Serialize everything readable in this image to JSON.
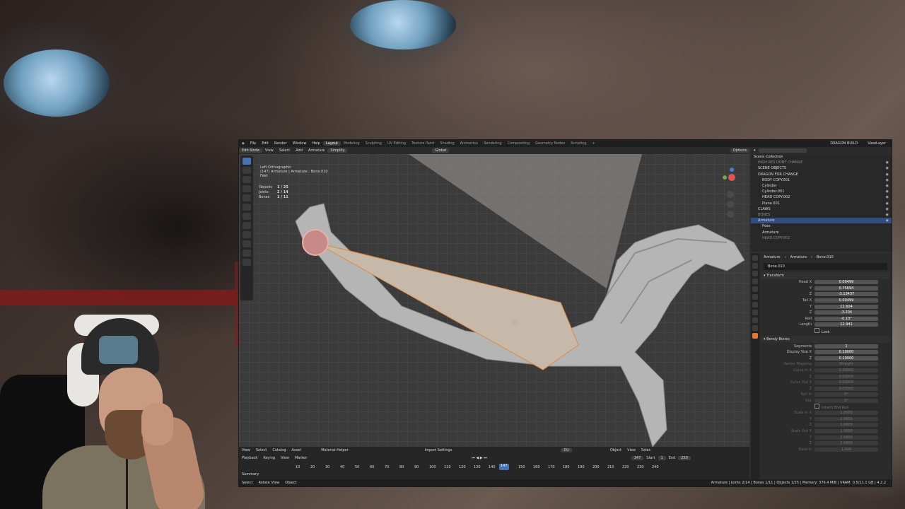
{
  "colors": {
    "accent": "#4772b3",
    "active_orange": "#e07a2e",
    "selected_row": "#334d80"
  },
  "menubar": {
    "menus": [
      "File",
      "Edit",
      "Render",
      "Window",
      "Help"
    ],
    "workspaces": [
      "Layout",
      "Modeling",
      "Sculpting",
      "UV Editing",
      "Texture Paint",
      "Shading",
      "Animation",
      "Rendering",
      "Compositing",
      "Geometry Nodes",
      "Scripting"
    ],
    "active_workspace": "Layout",
    "add_tab": "+",
    "scene_name": "DRAGON BUILD",
    "view_layer": "ViewLayer"
  },
  "viewport_header": {
    "mode": "Edit Mode",
    "items": [
      "View",
      "Select",
      "Add",
      "Armature"
    ],
    "simplify": "Simplify",
    "orientation": "Global",
    "options": "Options"
  },
  "viewport": {
    "view_name": "Left Orthographic",
    "active_object": "(147) Armature | Armature : Bone.010",
    "collection": "Feet",
    "stats": [
      {
        "label": "Objects",
        "value": "1 / 25"
      },
      {
        "label": "Joints",
        "value": "2 / 14"
      },
      {
        "label": "Bones",
        "value": "1 / 11"
      }
    ]
  },
  "timeline": {
    "editor_items": [
      "View",
      "Select",
      "Catalog",
      "Asset"
    ],
    "material_helper": "Material Helper",
    "import_settings": "Import Settings",
    "search_value": "DU",
    "object_label": "Object",
    "right_items": [
      "View",
      "Selec"
    ],
    "playback_items": [
      "Playback",
      "Keying",
      "View",
      "Marker"
    ],
    "current_frame": "147",
    "start_label": "Start",
    "start_value": "1",
    "end_label": "End",
    "end_value": "250",
    "summary": "Summary",
    "ticks": [
      "10",
      "20",
      "30",
      "40",
      "50",
      "60",
      "70",
      "80",
      "90",
      "100",
      "110",
      "120",
      "130",
      "140",
      "147",
      "150",
      "160",
      "170",
      "180",
      "190",
      "200",
      "210",
      "220",
      "230",
      "240"
    ]
  },
  "statusbar": {
    "left": [
      "Select",
      "Rotate View",
      "Object"
    ],
    "right": "Armature | Joints 2/14 | Bones 1/11 | Objects 1/25 | Memory: 376.4 MiB | VRAM: 0.5/11.1 GB | 4.2.2"
  },
  "outliner": {
    "title": "Scene Collection",
    "search_placeholder": "",
    "rows": [
      {
        "label": "HIGH RES DONT CHANGE",
        "indent": 1,
        "dim": true
      },
      {
        "label": "SCENE OBJECTS",
        "indent": 1,
        "dim": false
      },
      {
        "label": "DRAGON FOR CHANGE",
        "indent": 1,
        "dim": false
      },
      {
        "label": "BODY COPY.001",
        "indent": 2,
        "dim": false
      },
      {
        "label": "Cylinder",
        "indent": 2,
        "dim": false
      },
      {
        "label": "Cylinder.001",
        "indent": 2,
        "dim": false
      },
      {
        "label": "HEAD COPY.002",
        "indent": 2,
        "dim": false
      },
      {
        "label": "Plane.001",
        "indent": 2,
        "dim": false
      },
      {
        "label": "CLAWS",
        "indent": 1,
        "dim": false
      },
      {
        "label": "BONES",
        "indent": 1,
        "dim": true
      },
      {
        "label": "Armature",
        "indent": 1,
        "dim": false,
        "selected": true
      },
      {
        "label": "Pose",
        "indent": 2,
        "dim": false
      },
      {
        "label": "Armature",
        "indent": 2,
        "dim": false
      },
      {
        "label": "HEAD COPY.002",
        "indent": 2,
        "dim": true
      }
    ]
  },
  "properties": {
    "breadcrumb": [
      "Armature",
      "Armature",
      "Bone.010"
    ],
    "bone_name": "Bone.010",
    "transform_title": "Transform",
    "transform_fields": [
      {
        "label": "Head X",
        "value": "0.00499"
      },
      {
        "label": "Y",
        "value": "0.75694"
      },
      {
        "label": "Z",
        "value": "-3.13437"
      },
      {
        "label": "Tail X",
        "value": "0.00499"
      },
      {
        "label": "Y",
        "value": "12.604"
      },
      {
        "label": "Z",
        "value": "-3.204"
      },
      {
        "label": "Roll",
        "value": "-0.13°"
      },
      {
        "label": "Length",
        "value": "12.941"
      }
    ],
    "lock_label": "Lock",
    "bendy_title": "Bendy Bones",
    "bendy_fields": [
      {
        "label": "Segments",
        "value": "1",
        "dim": false
      },
      {
        "label": "Display Size X",
        "value": "0.10000",
        "dim": false
      },
      {
        "label": "Z",
        "value": "0.10000",
        "dim": false
      },
      {
        "label": "Vertex Mapping",
        "value": "Straight",
        "dim": true
      },
      {
        "label": "Curve In X",
        "value": "0.00000",
        "dim": true
      },
      {
        "label": "Z",
        "value": "0.00000",
        "dim": true
      },
      {
        "label": "Curve Out X",
        "value": "0.00000",
        "dim": true
      },
      {
        "label": "Z",
        "value": "0.00000",
        "dim": true
      },
      {
        "label": "Roll In",
        "value": "0°",
        "dim": true
      },
      {
        "label": "Out",
        "value": "0°",
        "dim": true
      }
    ],
    "inherit_label": "Inherit End Roll",
    "scale_fields": [
      {
        "label": "Scale In X",
        "value": "1.0000"
      },
      {
        "label": "Y",
        "value": "1.0000"
      },
      {
        "label": "Z",
        "value": "1.0000"
      },
      {
        "label": "Scale Out X",
        "value": "1.0000"
      },
      {
        "label": "Y",
        "value": "1.0000"
      },
      {
        "label": "Z",
        "value": "1.0000"
      },
      {
        "label": "Ease In",
        "value": "1.000"
      }
    ]
  }
}
